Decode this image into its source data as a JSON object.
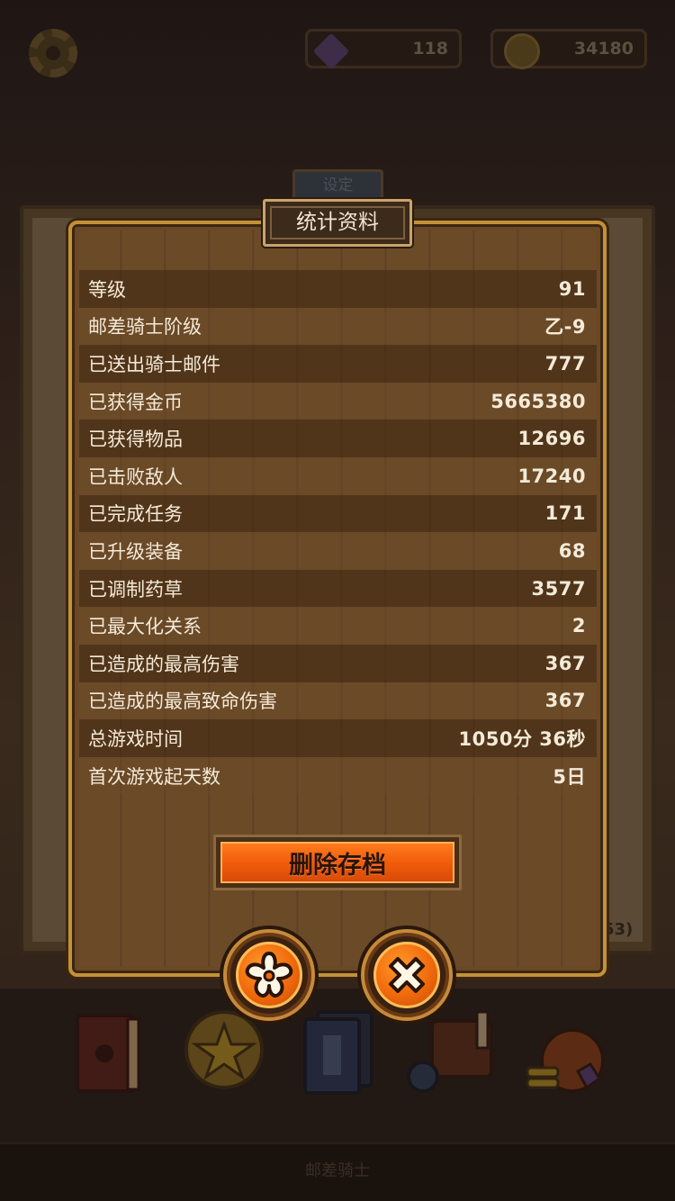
{
  "header": {
    "gems": "118",
    "gold": "34180"
  },
  "background": {
    "tab_label": "设定",
    "partial_badge": "53)",
    "bottom_label": "邮差骑士"
  },
  "dialog": {
    "title": "统计资料",
    "stats": [
      {
        "label": "等级",
        "value": "91"
      },
      {
        "label": "邮差骑士阶级",
        "value": "乙-9"
      },
      {
        "label": "已送出骑士邮件",
        "value": "777"
      },
      {
        "label": "已获得金币",
        "value": "5665380"
      },
      {
        "label": "已获得物品",
        "value": "12696"
      },
      {
        "label": "已击败敌人",
        "value": "17240"
      },
      {
        "label": "已完成任务",
        "value": "171"
      },
      {
        "label": "已升级装备",
        "value": "68"
      },
      {
        "label": "已调制药草",
        "value": "3577"
      },
      {
        "label": "已最大化关系",
        "value": "2"
      },
      {
        "label": "已造成的最高伤害",
        "value": "367"
      },
      {
        "label": "已造成的最高致命伤害",
        "value": "367"
      },
      {
        "label": "总游戏时间",
        "value": "1050分 36秒"
      },
      {
        "label": "首次游戏起天数",
        "value": "5日"
      }
    ],
    "delete_label": "删除存档"
  },
  "icons": {
    "settings": "asterisk-icon",
    "close": "close-icon"
  },
  "colors": {
    "accent_orange": "#f05a0a",
    "panel_brown": "#6b4a28",
    "frame_gold": "#c39236"
  }
}
